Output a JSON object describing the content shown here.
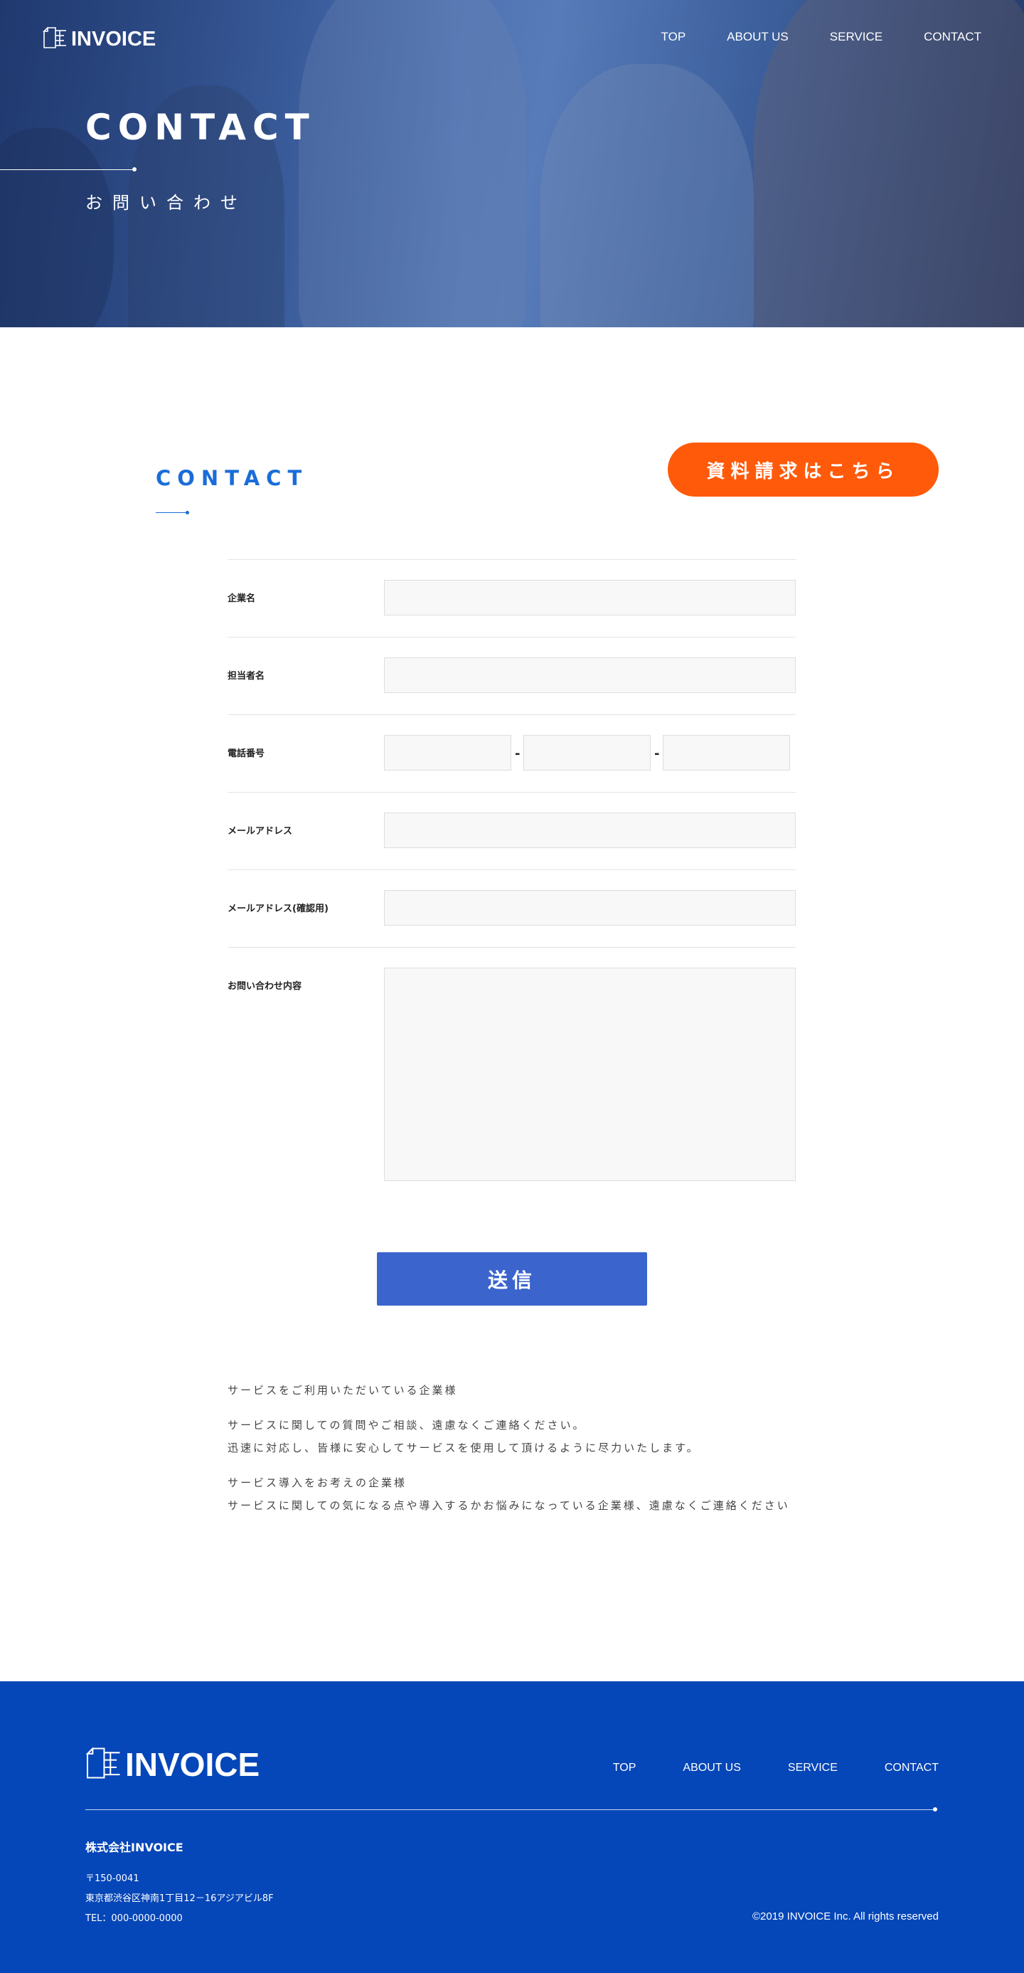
{
  "brand": {
    "name": "INVOICE"
  },
  "nav": {
    "items": [
      "TOP",
      "ABOUT US",
      "SERVICE",
      "CONTACT"
    ]
  },
  "hero": {
    "title": "CONTACT",
    "subtitle": "お問い合わせ"
  },
  "section": {
    "title": "CONTACT",
    "request_button": "資料請求はこちら"
  },
  "form": {
    "company_label": "企業名",
    "person_label": "担当者名",
    "tel_label": "電話番号",
    "tel_separator": "-",
    "email_label": "メールアドレス",
    "email_confirm_label": "メールアドレス(確認用)",
    "message_label": "お問い合わせ内容",
    "submit_label": "送信"
  },
  "notes": {
    "p1": "サービスをご利用いただいている企業様",
    "p2_line1": "サービスに関しての質問やご相談、遠慮なくご連絡ください。",
    "p2_line2": "迅速に対応し、皆様に安心してサービスを使用して頂けるように尽力いたします。",
    "p3_line1": "サービス導入をお考えの企業様",
    "p3_line2": "サービスに関しての気になる点や導入するかお悩みになっている企業様、遠慮なくご連絡ください"
  },
  "footer": {
    "nav": [
      "TOP",
      "ABOUT US",
      "SERVICE",
      "CONTACT"
    ],
    "company": "株式会社INVOICE",
    "postal": "〒150-0041",
    "address": "東京都渋谷区神南1丁目12－16アジアビル8F",
    "tel": "TEL：000-0000-0000",
    "copyright": "©2019 INVOICE Inc. All rights reserved"
  },
  "colors": {
    "accent_blue": "#1a6dd8",
    "request_orange": "#ff5a0a",
    "submit_blue": "#3b64cc",
    "footer_blue": "#0546b8"
  }
}
